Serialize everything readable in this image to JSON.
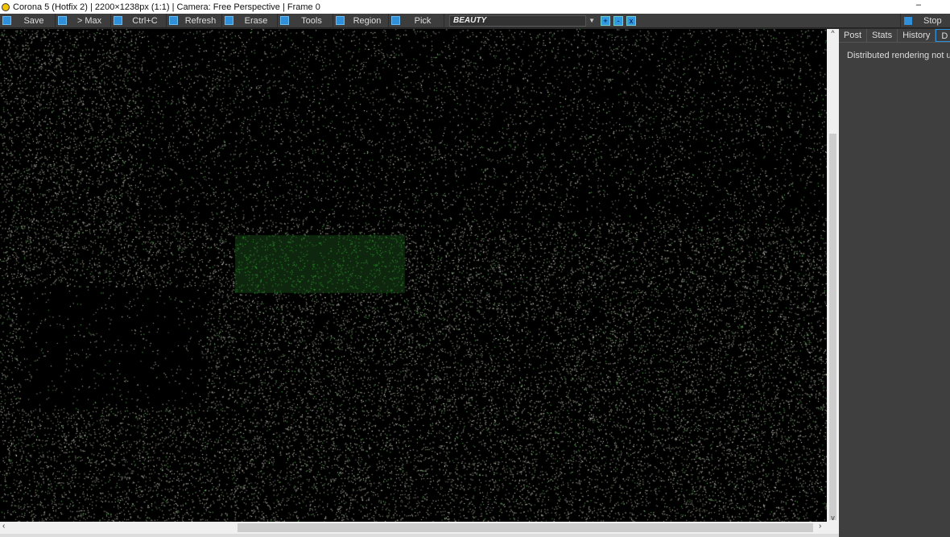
{
  "title": "Corona 5 (Hotfix 2) | 2200×1238px (1:1) | Camera: Free Perspective | Frame 0",
  "window_controls": {
    "minimize": "–"
  },
  "toolbar": {
    "save": "Save",
    "max": "> Max",
    "copy": "Ctrl+C",
    "refresh": "Refresh",
    "erase": "Erase",
    "tools": "Tools",
    "region": "Region",
    "pick": "Pick",
    "pass": "BEAUTY",
    "zoom_in": "+",
    "zoom_out": "-",
    "zoom_fit": "x",
    "stop": "Stop"
  },
  "panel": {
    "tabs": [
      "Post",
      "Stats",
      "History",
      "D"
    ],
    "message": "Distributed rendering not us"
  },
  "scroll": {
    "up": "^",
    "down": "v",
    "left": "‹",
    "right": "›"
  },
  "colors": {
    "accent": "#2f8fd8",
    "noise_green": "#3fbf3f"
  }
}
